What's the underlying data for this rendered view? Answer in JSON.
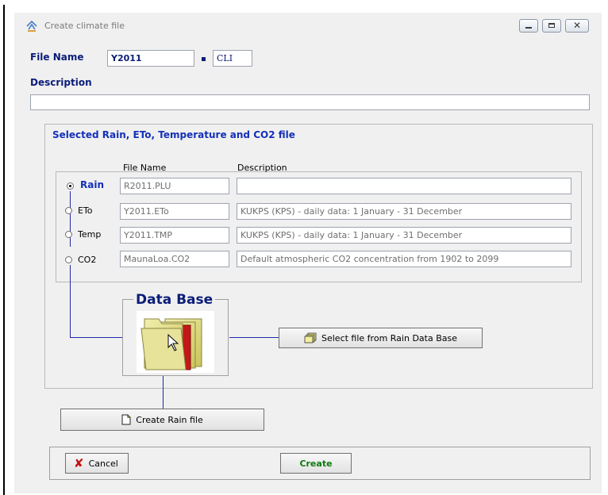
{
  "window": {
    "title": "Create climate file"
  },
  "file": {
    "name_label": "File Name",
    "name_value": "Y2011",
    "ext_value": "CLI",
    "description_label": "Description",
    "description_value": ""
  },
  "selection": {
    "title": "Selected Rain, ETo, Temperature and CO2 file",
    "col_file": "File Name",
    "col_desc": "Description",
    "rows": [
      {
        "label": "Rain",
        "file": "R2011.PLU",
        "desc": "",
        "selected": true
      },
      {
        "label": "ETo",
        "file": "Y2011.ETo",
        "desc": "KUKPS (KPS) - daily data: 1 January - 31 December",
        "selected": false
      },
      {
        "label": "Temp",
        "file": "Y2011.TMP",
        "desc": "KUKPS (KPS) - daily data: 1 January - 31 December",
        "selected": false
      },
      {
        "label": "CO2",
        "file": "MaunaLoa.CO2",
        "desc": "Default atmospheric CO2 concentration from 1902 to 2099",
        "selected": false
      }
    ]
  },
  "database": {
    "title": "Data Base",
    "select_button": "Select file from Rain Data Base"
  },
  "actions": {
    "create_rain": "Create Rain file",
    "cancel": "Cancel",
    "create": "Create"
  },
  "colors": {
    "accent": "#0a1d78",
    "connector": "#1e2aa6",
    "create_text": "#0b7a0b"
  }
}
